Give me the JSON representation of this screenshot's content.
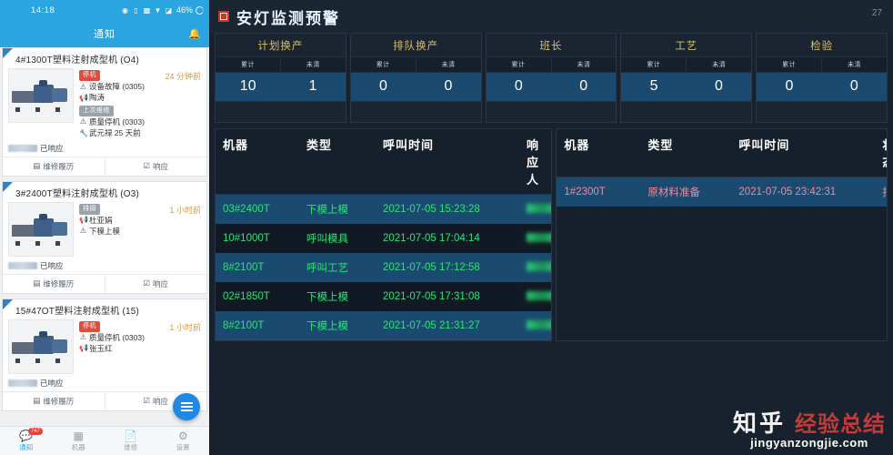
{
  "phone": {
    "statusbar": {
      "time": "14:18",
      "battery_pct": "46%",
      "icons": [
        "alarm-icon",
        "vibrate-icon",
        "sd-card-icon",
        "wifi-icon",
        "signal-icon"
      ]
    },
    "appbar": {
      "title": "通知",
      "bell_icon": "bell-icon"
    },
    "cards": [
      {
        "title": "4#1300T塑料注射成型机 (O4)",
        "ago": "24 分钟前",
        "badge": "停机",
        "badge_type": "red",
        "lines": [
          {
            "icon": "warning-icon",
            "text": "设备故障 (0305)"
          },
          {
            "icon": "megaphone-icon",
            "text": "陶涛"
          }
        ],
        "sub_badge": "上次维修",
        "sub_lines": [
          {
            "icon": "warning-icon",
            "text": "质量停机 (0303)"
          },
          {
            "icon": "wrench-icon",
            "text": "武元禄 25 天前"
          }
        ],
        "response_status": "已响应",
        "actions": [
          "维修履历",
          "响应"
        ]
      },
      {
        "title": "3#2400T塑料注射成型机 (O3)",
        "ago": "1 小时前",
        "badge": "排阅",
        "badge_type": "gray",
        "lines": [
          {
            "icon": "megaphone-icon",
            "text": "杜亚娟"
          },
          {
            "icon": "warning-icon",
            "text": "下模上模"
          }
        ],
        "sub_badge": "",
        "sub_lines": [],
        "response_status": "已响应",
        "actions": [
          "维修履历",
          "响应"
        ]
      },
      {
        "title": "15#47OT塑料注射成型机 (15)",
        "ago": "1 小时前",
        "badge": "停机",
        "badge_type": "red",
        "lines": [
          {
            "icon": "warning-icon",
            "text": "质量停机 (0303)"
          },
          {
            "icon": "megaphone-icon",
            "text": "张玉红"
          }
        ],
        "sub_badge": "",
        "sub_lines": [],
        "response_status": "已响应",
        "actions": [
          "维修履历",
          "响应"
        ]
      }
    ],
    "fab_icon": "menu-icon",
    "tabs": [
      {
        "label": "通知",
        "icon": "chat-icon",
        "badge": "747",
        "active": true
      },
      {
        "label": "机器",
        "icon": "grid-icon",
        "badge": "",
        "active": false
      },
      {
        "label": "维修",
        "icon": "document-icon",
        "badge": "",
        "active": false
      },
      {
        "label": "设置",
        "icon": "gear-icon",
        "badge": "",
        "active": false
      }
    ]
  },
  "dashboard": {
    "logo_icon": "alarm-light-icon",
    "title": "安灯监测预警",
    "count": "27",
    "accent_title": "#d9c06a",
    "accent_value_bg": "#1b4a70",
    "stats": [
      {
        "name": "计划换产",
        "sub": [
          "累计",
          "未清"
        ],
        "values": [
          "10",
          "1"
        ]
      },
      {
        "name": "排队换产",
        "sub": [
          "累计",
          "未清"
        ],
        "values": [
          "0",
          "0"
        ]
      },
      {
        "name": "班长",
        "sub": [
          "累计",
          "未清"
        ],
        "values": [
          "0",
          "0"
        ]
      },
      {
        "name": "工艺",
        "sub": [
          "累计",
          "未清"
        ],
        "values": [
          "5",
          "0"
        ]
      },
      {
        "name": "检验",
        "sub": [
          "累计",
          "未清"
        ],
        "values": [
          "0",
          "0"
        ]
      }
    ],
    "left_table": {
      "headers": [
        "机器",
        "类型",
        "呼叫时间",
        "响应人"
      ],
      "rows": [
        {
          "machine": "03#2400T",
          "type": "下模上模",
          "time": "2021-07-05 15:23:28",
          "responder": ""
        },
        {
          "machine": "10#1000T",
          "type": "呼叫模具",
          "time": "2021-07-05 17:04:14",
          "responder": ""
        },
        {
          "machine": "8#2100T",
          "type": "呼叫工艺",
          "time": "2021-07-05 17:12:58",
          "responder": ""
        },
        {
          "machine": "02#1850T",
          "type": "下模上模",
          "time": "2021-07-05 17:31:08",
          "responder": ""
        },
        {
          "machine": "8#2100T",
          "type": "下模上模",
          "time": "2021-07-05 21:31:27",
          "responder": ""
        }
      ]
    },
    "right_table": {
      "headers": [
        "机器",
        "类型",
        "呼叫时间",
        "状态"
      ],
      "rows": [
        {
          "machine": "1#2300T",
          "type": "原材料准备",
          "time": "2021-07-05 23:42:31",
          "status": "报警"
        }
      ]
    },
    "watermark": {
      "brand": "知乎",
      "label": "经验总结",
      "url": "jingyanzongjie.com"
    }
  }
}
